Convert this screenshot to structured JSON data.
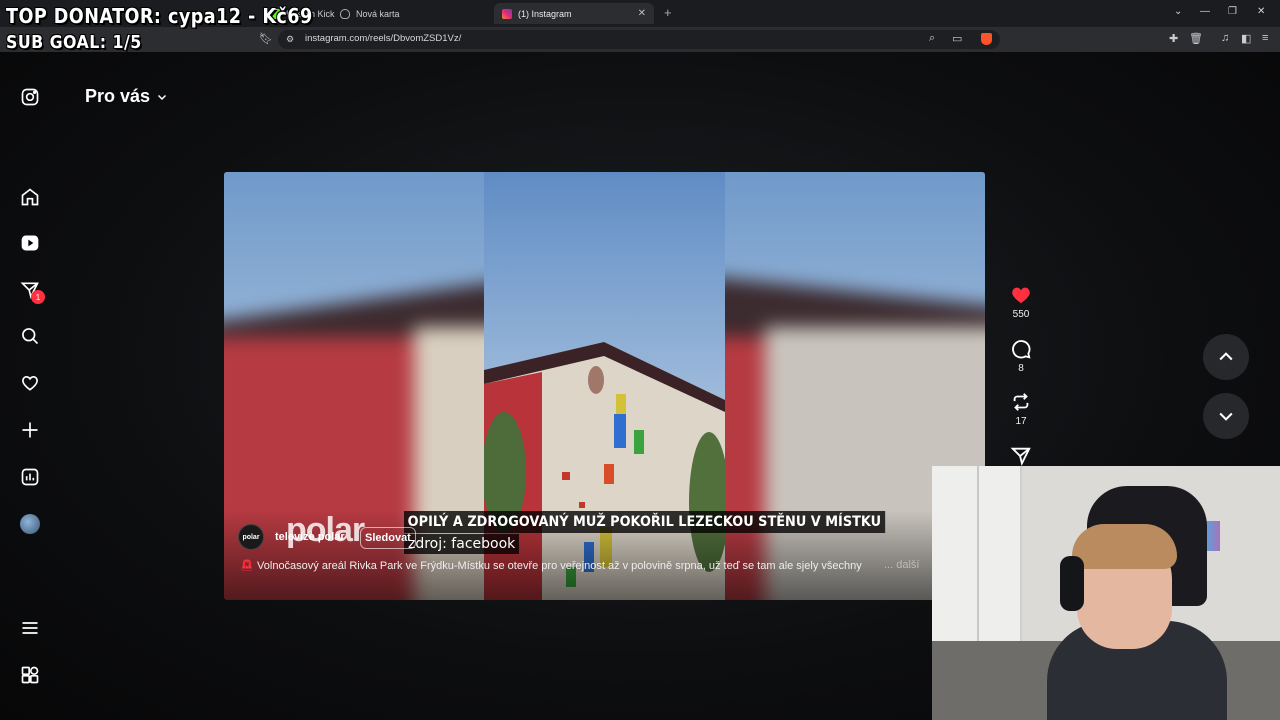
{
  "browser": {
    "tabs": [
      {
        "label": "Live on Kick"
      },
      {
        "label": "Nová karta"
      },
      {
        "label": "(1) Instagram",
        "active": true
      }
    ],
    "url": "instagram.com/reels/DbvomZSD1Vz/"
  },
  "overlay": {
    "line1": "TOP DONATOR: cypa12 - Kč69",
    "line2": "SUB GOAL: 1/5"
  },
  "sidebar": {
    "notification_count": "1"
  },
  "feed": {
    "title": "Pro vás"
  },
  "reel": {
    "headline": "OPILÝ A ZDROGOVANÝ MUŽ POKOŘIL LEZECKOU STĚNU V MÍSTKU",
    "source": "zdroj: facebook",
    "watermark": "polar",
    "author_avatar_text": "polar",
    "author": "televize polar",
    "follow_label": "Sledovat",
    "description": "Volnočasový areál Rivka Park ve Frýdku-Místku se otevře pro veřejnost až v polovině srpna, už teď se tam ale sjely všechny",
    "more_label": "... další",
    "likes": "550",
    "comments": "8",
    "reposts": "17"
  },
  "colors": {
    "like": "#ff3040",
    "brand_badge": "#fb542b",
    "background": "#0d0e10"
  }
}
